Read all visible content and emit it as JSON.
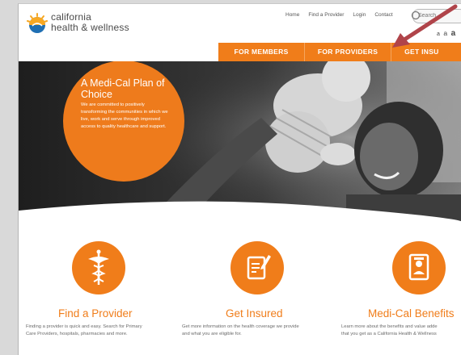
{
  "brand": {
    "line1": "california",
    "line2": "health & wellness",
    "colors": {
      "orange": "#f07d1a",
      "gray": "#4a4a4a"
    }
  },
  "utility_nav": [
    "Home",
    "Find a Provider",
    "Login",
    "Contact"
  ],
  "search": {
    "value": "",
    "placeholder": "Search"
  },
  "text_size": {
    "label_small": "a",
    "label_medium": "a",
    "label_large": "a"
  },
  "main_nav": {
    "members": "FOR MEMBERS",
    "providers": "FOR PROVIDERS",
    "insured": "GET INSU"
  },
  "hero": {
    "title": "A Medi-Cal Plan of Choice",
    "body": "We are committed to positively transforming the communities in which we live, work and serve through improved access to quality healthcare and support."
  },
  "features": [
    {
      "icon": "caduceus-icon",
      "title": "Find a Provider",
      "desc_line1": "Finding a provider is quick and easy. Search for Primary",
      "desc_line2": "Care Providers, hospitals, pharmacies and more."
    },
    {
      "icon": "clipboard-pen-icon",
      "title": "Get Insured",
      "desc_line1": "Get more information on the health coverage we provide",
      "desc_line2": "and what you are eligible for."
    },
    {
      "icon": "id-card-icon",
      "title": "Medi-Cal Benefits",
      "desc_line1": "Learn more about the benefits and value adde",
      "desc_line2": "that you get as a California Health & Wellness"
    }
  ]
}
